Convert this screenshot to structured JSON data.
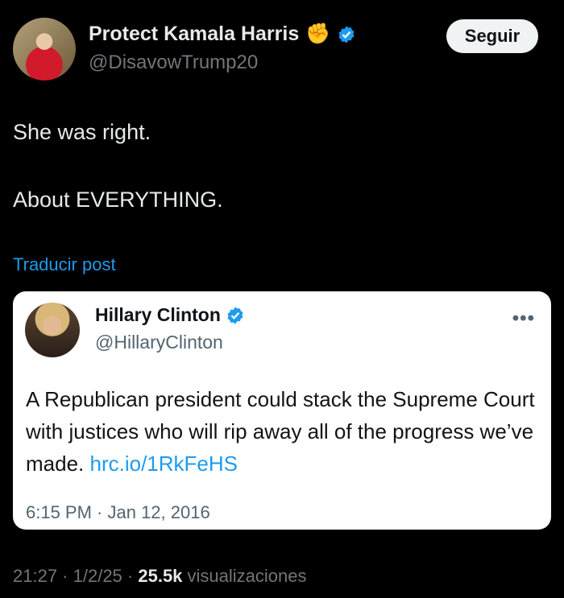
{
  "author": {
    "display_name": "Protect Kamala Harris",
    "emoji": "✊",
    "handle": "@DisavowTrump20",
    "follow_label": "Seguir"
  },
  "tweet": {
    "line1": "She was right.",
    "line2": "About EVERYTHING.",
    "translate_label": "Traducir post"
  },
  "quoted": {
    "display_name": "Hillary Clinton",
    "handle": "@HillaryClinton",
    "more_label": "•••",
    "text": "A Republican president could stack the Supreme Court with justices who will rip away all of the progress we’ve made.",
    "link": "hrc.io/1RkFeHS",
    "timestamp": "6:15 PM · Jan 12, 2016"
  },
  "meta": {
    "time": "21:27",
    "sep1": " · ",
    "date": "1/2/25",
    "sep2": " · ",
    "views_count": "25.5k",
    "views_label": " visualizaciones"
  },
  "colors": {
    "accent": "#1d9bf0",
    "verified": "#1d9bf0",
    "background": "#000000"
  }
}
